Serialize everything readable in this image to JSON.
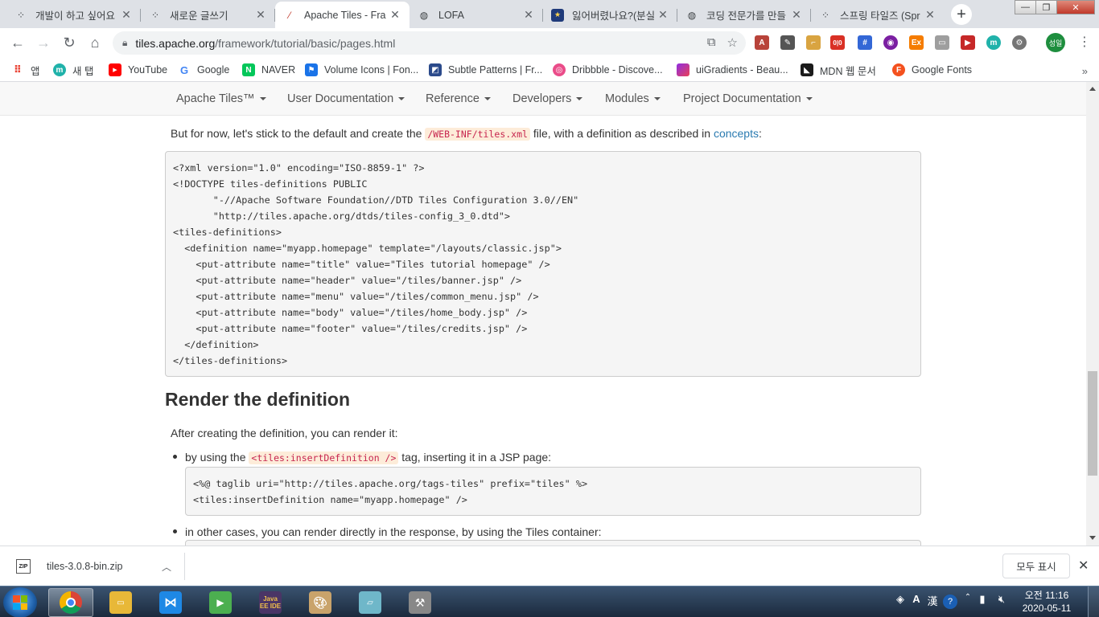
{
  "tabs": [
    {
      "title": "개발이 하고 싶어요",
      "icon": "dots-icon"
    },
    {
      "title": "새로운 글쓰기",
      "icon": "dots-icon"
    },
    {
      "title": "Apache Tiles - Fra",
      "icon": "feather-icon"
    },
    {
      "title": "LOFA",
      "icon": "globe-icon"
    },
    {
      "title": "잃어버렸나요?(분실",
      "icon": "badge-icon"
    },
    {
      "title": "코딩 전문가를 만들",
      "icon": "globe-icon"
    },
    {
      "title": "스프링 타일즈 (Spr",
      "icon": "dots-icon"
    }
  ],
  "address": {
    "host": "tiles.apache.org",
    "path": "/framework/tutorial/basic/pages.html"
  },
  "profile_label": "성일",
  "bookmarks": [
    {
      "label": "앱",
      "color": "#ea4335"
    },
    {
      "label": "새 탭",
      "color": "#20b2aa"
    },
    {
      "label": "YouTube",
      "color": "#ff0000"
    },
    {
      "label": "Google",
      "color": "#4285f4"
    },
    {
      "label": "NAVER",
      "color": "#03c75a"
    },
    {
      "label": "Volume Icons | Fon...",
      "color": "#1a73e8"
    },
    {
      "label": "Subtle Patterns | Fr...",
      "color": "#2b4a8b"
    },
    {
      "label": "Dribbble - Discove...",
      "color": "#ea4c89"
    },
    {
      "label": "uiGradients - Beau...",
      "color": "#8e2de2"
    },
    {
      "label": "MDN 웹 문서",
      "color": "#1b1b1b"
    },
    {
      "label": "Google Fonts",
      "color": "#f4511e"
    }
  ],
  "site_nav": [
    "Apache Tiles™",
    "User Documentation",
    "Reference",
    "Developers",
    "Modules",
    "Project Documentation"
  ],
  "content": {
    "intro_before": "But for now, let's stick to the default and create the ",
    "intro_code": "/WEB-INF/tiles.xml",
    "intro_mid": " file, with a definition as described in ",
    "intro_link": "concepts",
    "intro_after": ":",
    "xml_lines": [
      "<?xml version=\"1.0\" encoding=\"ISO-8859-1\" ?>",
      "<!DOCTYPE tiles-definitions PUBLIC",
      "       \"-//Apache Software Foundation//DTD Tiles Configuration 3.0//EN\"",
      "       \"http://tiles.apache.org/dtds/tiles-config_3_0.dtd\">",
      "<tiles-definitions>",
      "  <definition name=\"myapp.homepage\" template=\"/layouts/classic.jsp\">",
      "    <put-attribute name=\"title\" value=\"Tiles tutorial homepage\" />",
      "    <put-attribute name=\"header\" value=\"/tiles/banner.jsp\" />",
      "    <put-attribute name=\"menu\" value=\"/tiles/common_menu.jsp\" />",
      "    <put-attribute name=\"body\" value=\"/tiles/home_body.jsp\" />",
      "    <put-attribute name=\"footer\" value=\"/tiles/credits.jsp\" />",
      "  </definition>",
      "</tiles-definitions>"
    ],
    "heading": "Render the definition",
    "after_heading": "After creating the definition, you can render it:",
    "bullet1_before": "by using the ",
    "bullet1_code": "<tiles:insertDefinition />",
    "bullet1_after": " tag, inserting it in a JSP page:",
    "jsp_lines": [
      "<%@ taglib uri=\"http://tiles.apache.org/tags-tiles\" prefix=\"tiles\" %>",
      "<tiles:insertDefinition name=\"myapp.homepage\" />"
    ],
    "bullet2": "in other cases, you can render directly in the response, by using the Tiles container:"
  },
  "download": {
    "filename": "tiles-3.0.8-bin.zip",
    "icon_label": "ZIP",
    "show_all": "모두 표시"
  },
  "taskbar": {
    "apps": [
      {
        "name": "chrome",
        "color": "#db4437"
      },
      {
        "name": "explorer",
        "color": "#e8b838"
      },
      {
        "name": "vscode",
        "color": "#1e88e5"
      },
      {
        "name": "media",
        "color": "#4caf50"
      },
      {
        "name": "java-ee-ide",
        "label": "Java EE IDE",
        "color": "#4a3566"
      },
      {
        "name": "paint",
        "color": "#c9a36b"
      },
      {
        "name": "notes",
        "color": "#6fb7c9"
      },
      {
        "name": "tools",
        "color": "#888"
      }
    ],
    "ime_label": "A",
    "hanja_label": "漢",
    "help_label": "?",
    "time": "오전 11:16",
    "date": "2020-05-11"
  }
}
